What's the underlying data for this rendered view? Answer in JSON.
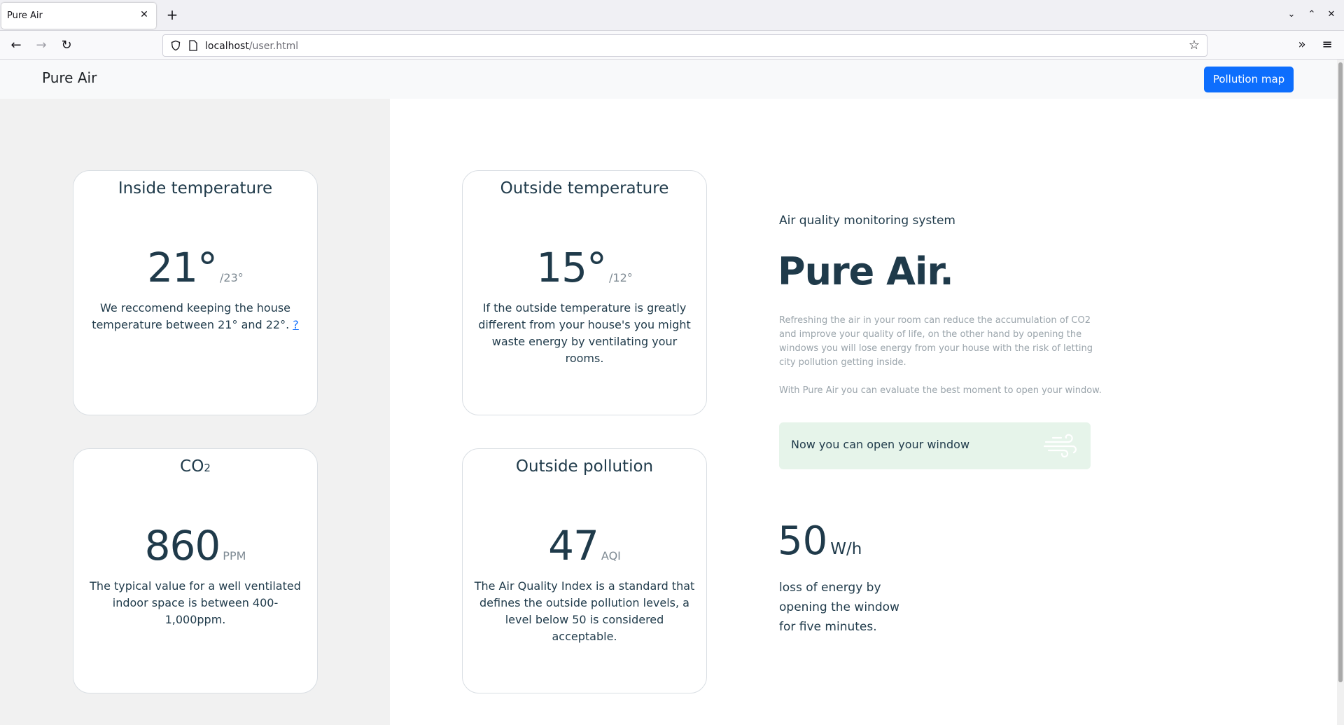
{
  "browser": {
    "tab_title": "Pure Air",
    "tab_close_icon": "close-icon",
    "new_tab_symbol": "+",
    "url_host": "localhost",
    "url_path": "/user.html"
  },
  "header": {
    "brand": "Pure Air",
    "pollution_map_button": "Pollution map",
    "accent_color": "#0d6efd"
  },
  "cards": {
    "inside_temp": {
      "title": "Inside temperature",
      "value": "21°",
      "unit": "/23°",
      "text": "We reccomend keeping the house temperature between 21° and 22°.",
      "link": "?"
    },
    "outside_temp": {
      "title": "Outside temperature",
      "value": "15°",
      "unit": "/12°",
      "text": "If the outside temperature is greatly different from your house's you might waste energy by ventilating your rooms."
    },
    "co2": {
      "title_main": "CO",
      "title_sub": "2",
      "value": "860",
      "unit": "PPM",
      "text": "The typical value for a well ventilated indoor space is between 400-1,000ppm."
    },
    "pollution": {
      "title": "Outside pollution",
      "value": "47",
      "unit": "AQI",
      "text": "The Air Quality Index is a standard that defines the outside pollution levels, a level below 50 is considered acceptable."
    }
  },
  "info": {
    "intro": "Air quality monitoring system",
    "hero": "Pure Air.",
    "description": "Refreshing the air in your room can reduce the accumulation of CO2 and improve your quality of life, on the other hand by opening the windows you will lose energy from your house with the risk of letting city pollution getting inside.",
    "description2": "With Pure Air you can evaluate the best moment to open your window.",
    "alert": "Now you can open your window",
    "alert_color": "#e6f4ea",
    "energy_value": "50",
    "energy_unit": "W/h",
    "energy_text": "loss of energy by opening the window for five minutes."
  }
}
